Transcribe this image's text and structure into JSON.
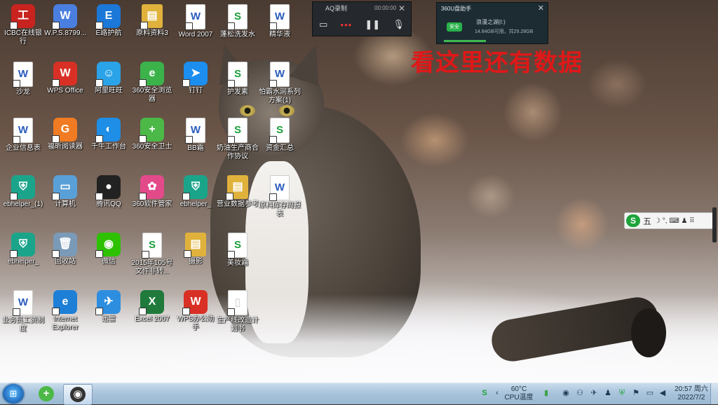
{
  "desktop": {
    "icons": [
      {
        "label": "ICBC在线银行",
        "glyph": "工",
        "color": "#c8231f",
        "kind": "app"
      },
      {
        "label": "W.P.S.8799...",
        "glyph": "W",
        "color": "#4a7fe0",
        "kind": "app"
      },
      {
        "label": "E路护航",
        "glyph": "E",
        "color": "#1b78d8",
        "kind": "app"
      },
      {
        "label": "原料资料3",
        "glyph": "▤",
        "color": "#e0b23c",
        "kind": "folder"
      },
      {
        "label": "Word 2007",
        "glyph": "W",
        "color": "#2a5cbd",
        "kind": "word"
      },
      {
        "label": "蓬松洗发水",
        "glyph": "S",
        "color": "#1a9d3a",
        "kind": "sheet"
      },
      {
        "label": "精华液",
        "glyph": "W",
        "color": "#2a5cbd",
        "kind": "word"
      },
      {
        "label": "沙龙",
        "glyph": "W",
        "color": "#2a5cbd",
        "kind": "word"
      },
      {
        "label": "WPS Office",
        "glyph": "W",
        "color": "#d93025",
        "kind": "app"
      },
      {
        "label": "阿里旺旺",
        "glyph": "☺",
        "color": "#2aa3e8",
        "kind": "app"
      },
      {
        "label": "360安全浏览器",
        "glyph": "e",
        "color": "#3bb34a",
        "kind": "app"
      },
      {
        "label": "钉钉",
        "glyph": "➤",
        "color": "#1b8ef0",
        "kind": "app"
      },
      {
        "label": "护发素",
        "glyph": "S",
        "color": "#1a9d3a",
        "kind": "sheet"
      },
      {
        "label": "怕霸水润系列方案(1)",
        "glyph": "W",
        "color": "#2a5cbd",
        "kind": "word"
      },
      {
        "label": "企业信息表",
        "glyph": "W",
        "color": "#2a5cbd",
        "kind": "word"
      },
      {
        "label": "福昕阅读器",
        "glyph": "G",
        "color": "#f07b22",
        "kind": "app"
      },
      {
        "label": "千牛工作台",
        "glyph": "◐",
        "color": "#1e8ee6",
        "kind": "app"
      },
      {
        "label": "360安全卫士",
        "glyph": "+",
        "color": "#4cb848",
        "kind": "app"
      },
      {
        "label": "BB霜",
        "glyph": "W",
        "color": "#2a5cbd",
        "kind": "word"
      },
      {
        "label": "奶油生产商合作协议",
        "glyph": "S",
        "color": "#1a9d3a",
        "kind": "sheet"
      },
      {
        "label": "资金汇总",
        "glyph": "S",
        "color": "#1a9d3a",
        "kind": "sheet"
      },
      {
        "label": "ebhelper_(1)",
        "glyph": "⛨",
        "color": "#1aa58b",
        "kind": "app"
      },
      {
        "label": "计算机",
        "glyph": "▭",
        "color": "#5aa0d8",
        "kind": "app"
      },
      {
        "label": "腾讯QQ",
        "glyph": "●",
        "color": "#222222",
        "kind": "app"
      },
      {
        "label": "360软件管家",
        "glyph": "✿",
        "color": "#e24a8a",
        "kind": "app"
      },
      {
        "label": "ebhelper_",
        "glyph": "⛨",
        "color": "#1aa58b",
        "kind": "app"
      },
      {
        "label": "营业数据参考",
        "glyph": "▤",
        "color": "#e0b23c",
        "kind": "folder"
      },
      {
        "label": "原料库存周报表",
        "glyph": "W",
        "color": "#2a5cbd",
        "kind": "word"
      },
      {
        "label": "ebhelper_",
        "glyph": "⛨",
        "color": "#1aa58b",
        "kind": "app"
      },
      {
        "label": "回收站",
        "glyph": "🗑",
        "color": "#7a9ab8",
        "kind": "app"
      },
      {
        "label": "微信",
        "glyph": "◉",
        "color": "#2dc100",
        "kind": "app"
      },
      {
        "label": "2015年105号文件非转...",
        "glyph": "S",
        "color": "#1a9d3a",
        "kind": "sheet"
      },
      {
        "label": "摄影",
        "glyph": "▤",
        "color": "#e0b23c",
        "kind": "folder"
      },
      {
        "label": "美妆霜",
        "glyph": "S",
        "color": "#1a9d3a",
        "kind": "sheet"
      },
      {
        "label": "业务员工资制度",
        "glyph": "W",
        "color": "#2a5cbd",
        "kind": "word"
      },
      {
        "label": "Internet Explorer",
        "glyph": "e",
        "color": "#1e7fd6",
        "kind": "app"
      },
      {
        "label": "迅雷",
        "glyph": "✈",
        "color": "#2d8ee0",
        "kind": "app"
      },
      {
        "label": "Excel 2007",
        "glyph": "X",
        "color": "#1f7a3c",
        "kind": "app"
      },
      {
        "label": "WPS办公助手",
        "glyph": "W",
        "color": "#d93025",
        "kind": "app"
      },
      {
        "label": "生产线改造计划书",
        "glyph": "▯",
        "color": "#dddddd",
        "kind": "doc"
      }
    ]
  },
  "recorder": {
    "title": "AQ录制",
    "time": "00:00:00",
    "close": "✕"
  },
  "u360": {
    "title": "360U盘助手",
    "close": "✕",
    "badge": "安全",
    "drive": "浪漫之湖(I:)",
    "space": "14.84GB可用，共29.28GB"
  },
  "overlay": {
    "text": "看这里还有数据"
  },
  "ime": {
    "logo": "S",
    "mode": "五",
    "icons": "☽ °, ⌨ ♟ ⠿"
  },
  "taskbar": {
    "start_glyph": "⊞",
    "apps": [
      {
        "name": "360",
        "glyph": "+",
        "color": "#4cb848"
      },
      {
        "name": "qq-recorder",
        "glyph": "◉",
        "color": "#333333"
      }
    ],
    "temp": "60°C",
    "temp_label": "CPU温度",
    "clock_time": "20:57 周六",
    "clock_date": "2022/7/2"
  }
}
